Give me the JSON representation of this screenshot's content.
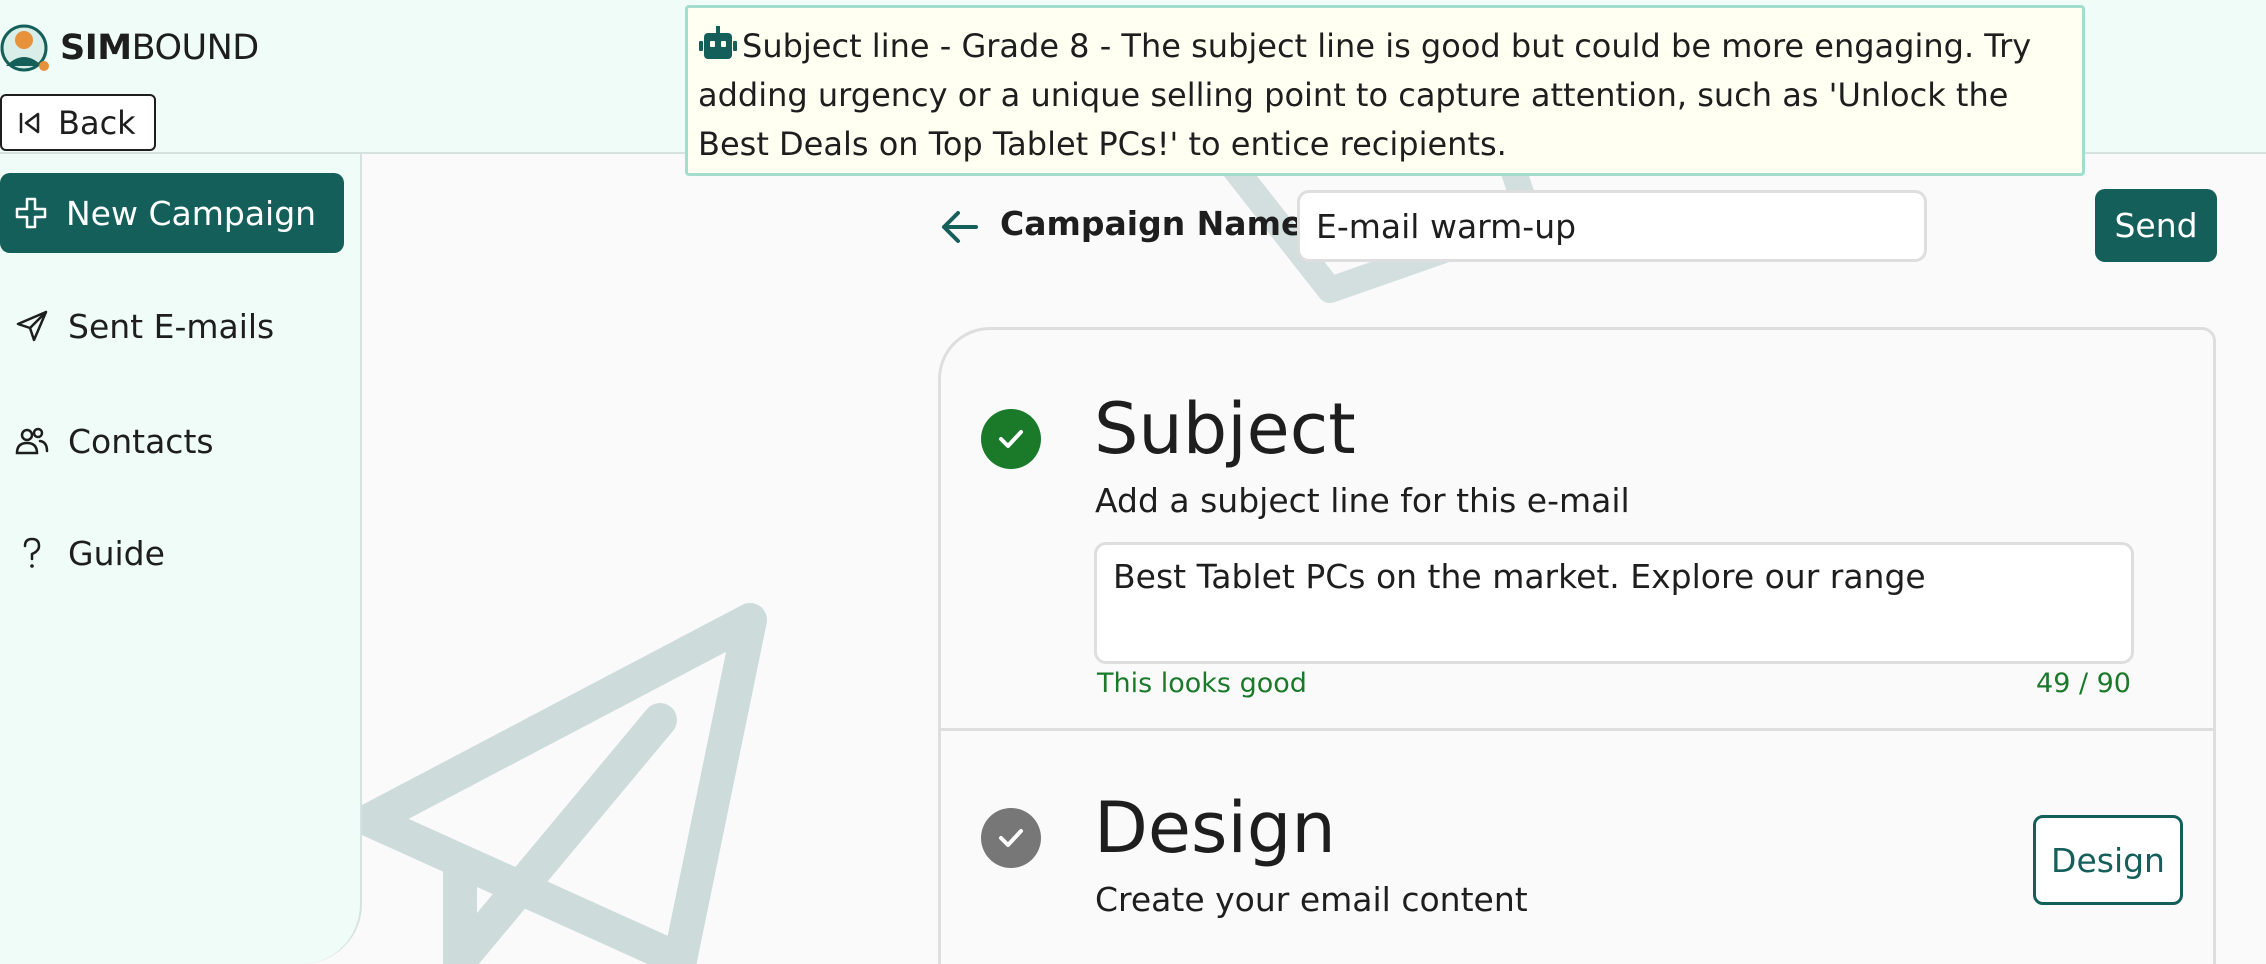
{
  "app": {
    "brand_bold": "SIM",
    "brand_light": "BOUND"
  },
  "header": {
    "back_label": "Back"
  },
  "sidebar": {
    "new_campaign_label": "New Campaign",
    "items": [
      {
        "label": "Sent E-mails",
        "icon": "send-icon"
      },
      {
        "label": "Contacts",
        "icon": "users-icon"
      },
      {
        "label": "Guide",
        "icon": "question-icon"
      }
    ]
  },
  "tooltip": {
    "icon": "robot-icon",
    "text": "Subject line - Grade 8 - The subject line is good but could be more engaging. Try adding urgency or a unique selling point to capture attention, such as 'Unlock the Best Deals on Top Tablet PCs!' to entice recipients."
  },
  "campaign": {
    "name_label": "Campaign Name:",
    "name_value": "E-mail warm-up",
    "send_label": "Send"
  },
  "steps": {
    "subject": {
      "title": "Subject",
      "description": "Add a subject line for this e-mail",
      "value": "Best Tablet PCs on the market. Explore our range",
      "hint": "This looks good",
      "count": "49 / 90",
      "status": "complete"
    },
    "design": {
      "title": "Design",
      "description": "Create your email content",
      "button_label": "Design",
      "status": "pending"
    }
  },
  "colors": {
    "brand": "#155f5b",
    "header_bg": "#effcf7",
    "success": "#1a7a2a",
    "pending": "#777777",
    "tooltip_border": "#a4dccd"
  }
}
